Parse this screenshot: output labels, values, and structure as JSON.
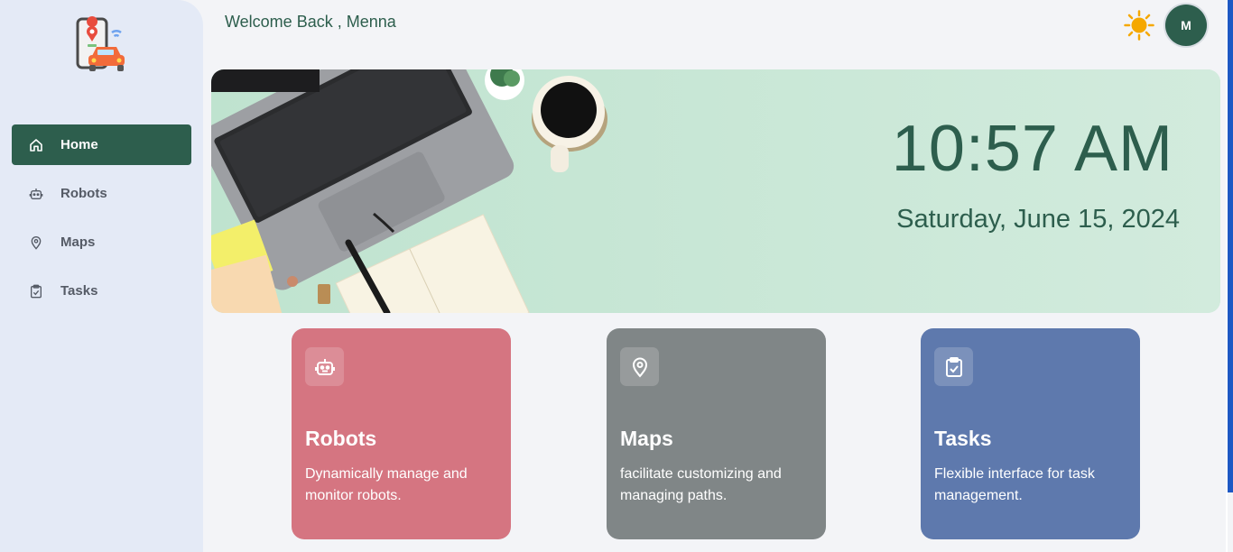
{
  "sidebar": {
    "items": [
      {
        "label": "Home",
        "icon": "home-icon",
        "active": true
      },
      {
        "label": "Robots",
        "icon": "robot-icon",
        "active": false
      },
      {
        "label": "Maps",
        "icon": "map-pin-icon",
        "active": false
      },
      {
        "label": "Tasks",
        "icon": "clipboard-check-icon",
        "active": false
      }
    ]
  },
  "header": {
    "welcome": "Welcome Back , Menna",
    "theme_icon": "sun-icon",
    "avatar_initial": "M"
  },
  "hero": {
    "time": "10:57 AM",
    "date": "Saturday, June 15, 2024"
  },
  "cards": [
    {
      "title": "Robots",
      "description": "Dynamically manage and monitor robots.",
      "icon": "robot-icon",
      "color": "#d57581"
    },
    {
      "title": "Maps",
      "description": "facilitate customizing and managing paths.",
      "icon": "map-pin-icon",
      "color": "#808687"
    },
    {
      "title": "Tasks",
      "description": "Flexible interface for task management.",
      "icon": "clipboard-check-icon",
      "color": "#5e79ad"
    }
  ],
  "colors": {
    "primary": "#2d5e4d",
    "sidebar_bg": "#e4eaf6",
    "page_bg": "#f3f4f7"
  }
}
